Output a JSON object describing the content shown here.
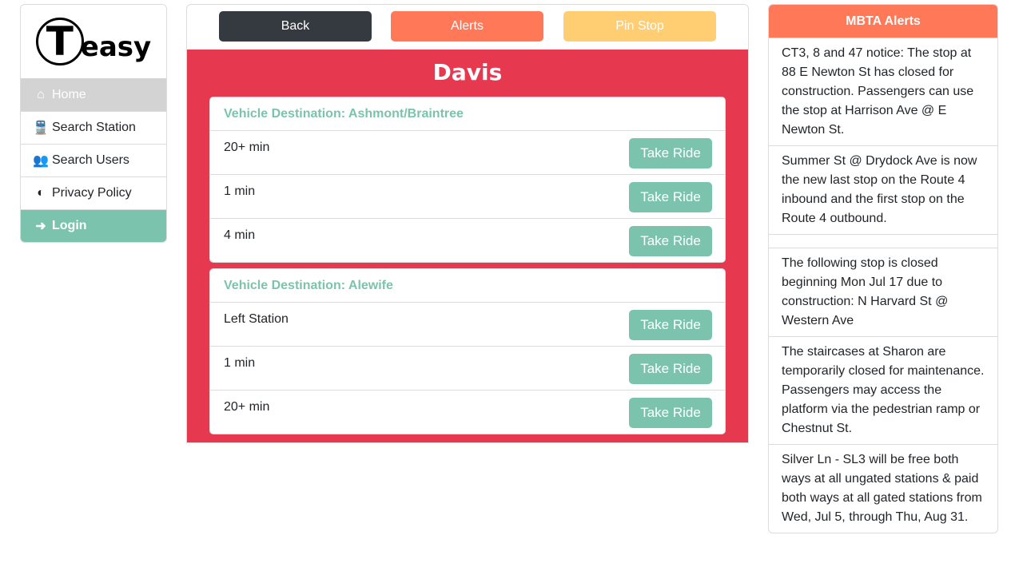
{
  "logo": {
    "text": "Teasy"
  },
  "sidebar": {
    "items": [
      {
        "label": "Home"
      },
      {
        "label": "Search Station"
      },
      {
        "label": "Search Users"
      },
      {
        "label": "Privacy Policy"
      },
      {
        "label": "Login"
      }
    ]
  },
  "toolbar": {
    "back": "Back",
    "alerts": "Alerts",
    "pin": "Pin Stop"
  },
  "station": {
    "name": "Davis",
    "groups": [
      {
        "destination": "Vehicle Destination: Ashmont/Braintree",
        "rows": [
          {
            "time": "20+ min",
            "action": "Take Ride"
          },
          {
            "time": "1 min",
            "action": "Take Ride"
          },
          {
            "time": "4 min",
            "action": "Take Ride"
          }
        ]
      },
      {
        "destination": "Vehicle Destination: Alewife",
        "rows": [
          {
            "time": "Left Station",
            "action": "Take Ride"
          },
          {
            "time": "1 min",
            "action": "Take Ride"
          },
          {
            "time": "20+ min",
            "action": "Take Ride"
          }
        ]
      }
    ]
  },
  "alerts": {
    "title": "MBTA Alerts",
    "items": [
      "CT3, 8 and 47 notice: The stop at 88 E Newton St has closed for construction. Passengers can use the stop at Harrison Ave @ E Newton St.",
      "Summer St @ Drydock Ave is now the new last stop on the Route 4 inbound and the first stop on the Route 4 outbound.",
      "",
      "The following stop is closed beginning Mon Jul 17 due to construction: N Harvard St @ Western Ave",
      "The staircases at Sharon are temporarily closed for maintenance. Passengers may access the platform via the pedestrian ramp or Chestnut St.",
      "Silver Ln - SL3 will be free both ways at all ungated stations & paid both ways at all gated stations from Wed, Jul 5, through Thu, Aug 31."
    ]
  }
}
